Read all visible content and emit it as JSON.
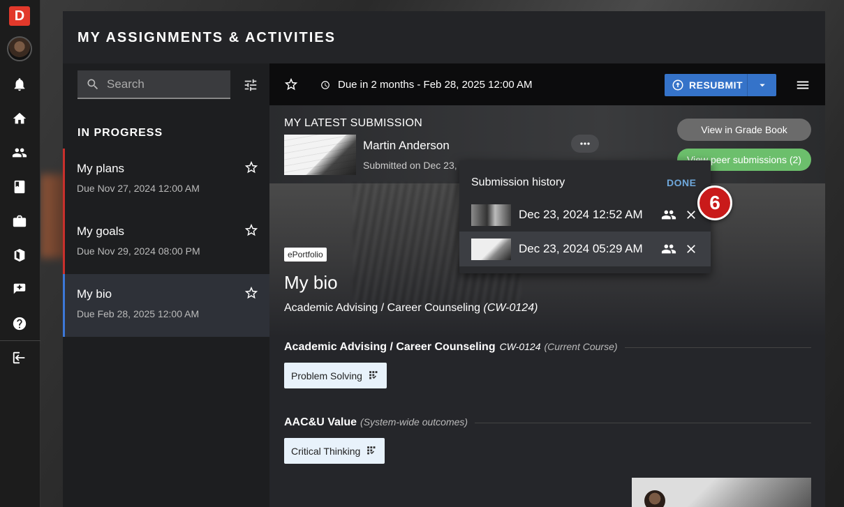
{
  "app": {
    "logo_letter": "D",
    "brand_color": "#e2392b"
  },
  "rail": {
    "icons": [
      "bell-icon",
      "home-icon",
      "people-icon",
      "book-icon",
      "briefcase-icon",
      "portfolio-icon",
      "badge-icon",
      "help-icon",
      "logout-icon"
    ]
  },
  "panel": {
    "title": "MY ASSIGNMENTS & ACTIVITIES"
  },
  "search": {
    "placeholder": "Search"
  },
  "list": {
    "section_label": "IN PROGRESS",
    "items": [
      {
        "title": "My plans",
        "due": "Due Nov 27, 2024 12:00 AM"
      },
      {
        "title": "My goals",
        "due": "Due Nov 29, 2024 08:00 PM"
      },
      {
        "title": "My bio",
        "due": "Due Feb 28, 2025 12:00 AM"
      }
    ]
  },
  "toolbar": {
    "due_text": "Due in 2 months - Feb 28, 2025 12:00 AM",
    "resubmit_label": "RESUBMIT",
    "accent": "#3573c9"
  },
  "latest": {
    "heading": "MY LATEST SUBMISSION",
    "author": "Martin Anderson",
    "submitted": "Submitted on Dec 23,",
    "gradebook_label": "View in Grade Book",
    "peer_label": "View peer submissions (2)"
  },
  "detail": {
    "tag": "ePortfolio",
    "title": "My bio",
    "course": "Academic Advising / Career Counseling",
    "course_code_paren": "(CW-0124)",
    "section1_name": "Academic Advising / Career Counseling",
    "section1_code": "CW-0124",
    "section1_note": "(Current Course)",
    "chip1": "Problem Solving",
    "section2_name": "AAC&U Value",
    "section2_note": "(System-wide outcomes)",
    "chip2": "Critical Thinking"
  },
  "history": {
    "title": "Submission history",
    "done_label": "DONE",
    "entries": [
      {
        "date": "Dec 23, 2024 12:52 AM"
      },
      {
        "date": "Dec 23, 2024 05:29 AM"
      }
    ]
  },
  "badge": {
    "number": "6",
    "color": "#c91a1a"
  }
}
